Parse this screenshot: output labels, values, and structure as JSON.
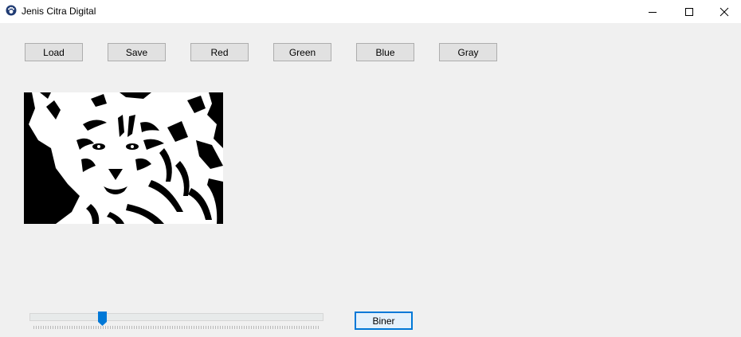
{
  "window": {
    "title": "Jenis Citra Digital",
    "icon": "paw-icon",
    "controls": [
      "minimize-icon",
      "maximize-icon",
      "close-icon"
    ]
  },
  "toolbar": {
    "load_label": "Load",
    "save_label": "Save",
    "red_label": "Red",
    "green_label": "Green",
    "blue_label": "Blue",
    "gray_label": "Gray"
  },
  "picture": {
    "description_icon": "image-preview",
    "mode": "binary black and white tiger"
  },
  "threshold": {
    "level_fraction": 0.24,
    "accent": "#0078d7"
  },
  "biner": {
    "label": "Biner"
  }
}
